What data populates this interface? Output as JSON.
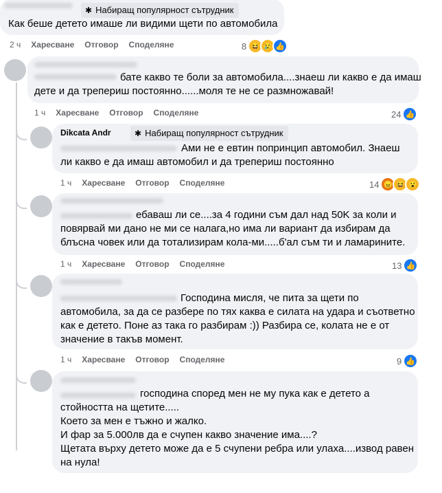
{
  "badge_label": "Набиращ популярност сътрудник",
  "actions": {
    "like": "Харесване",
    "reply": "Отговор",
    "share": "Споделяне"
  },
  "comments": [
    {
      "time": "2 ч",
      "text": "Как беше детето имаше ли видими щети по автомобила",
      "count": "8",
      "reactions": [
        "haha",
        "sad",
        "like"
      ]
    },
    {
      "time": "1 ч",
      "text": "бате какво те боли за автомобила....знаеш ли какво е да имаш\nдете и да трепериш постоянно......моля те не се размножавай!",
      "count": "24",
      "reactions": [
        "like"
      ]
    },
    {
      "author": "Dikcata Andr",
      "time": "1 ч",
      "text": "Ами не е евтин попринцип автомобил. Знаеш\nли какво е да имаш автомобил и да трепериш постоянно",
      "count": "14",
      "reactions": [
        "angry",
        "haha",
        "wow"
      ]
    },
    {
      "time": "1 ч",
      "text": "ебаваш ли се....за 4 години съм дал над 50K за коли и\nповярвай ми дано не ми се налага,но има ли вариант да избирам да\nблъсна човек или да тотализирам кола-ми.....б'ал съм ти и ламарините.",
      "count": "13",
      "reactions": [
        "like"
      ]
    },
    {
      "time": "1 ч",
      "text": "Господина мисля, че пита за щети по\nавтомобила, за да се разбере по тях каква е силата на удара и съответно\nкак е детето. Поне аз така го разбирам :)) Разбира се, колата не е от\nзначение в такъв момент.",
      "count": "9",
      "reactions": [
        "like"
      ]
    },
    {
      "text": "господина според мен не му пука как е детето а\nстойността на щетите.....\nКоето за мен е тъжно и жалко.\nИ фар за 5.000лв да е счупен какво значение има....?\nЩетата върху детето може да е 5 счупени ребра или улаха....извод равен\nна нула!"
    }
  ]
}
